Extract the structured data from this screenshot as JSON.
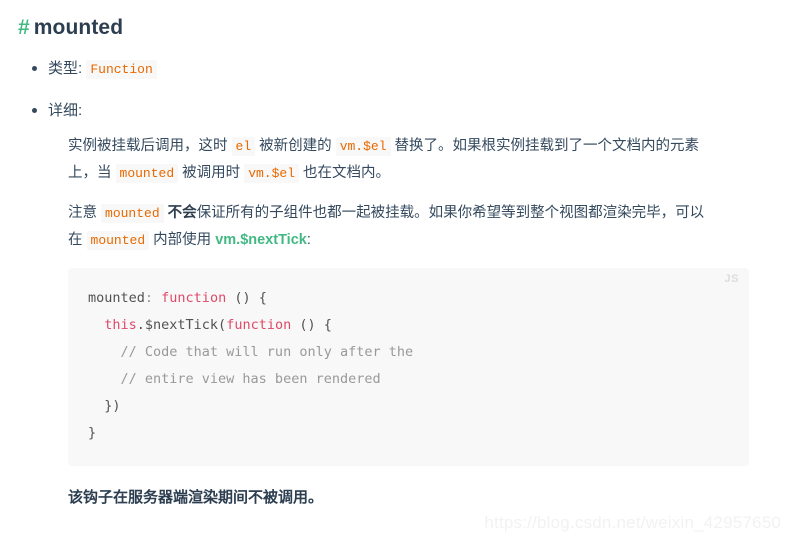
{
  "heading": {
    "anchor": "#",
    "text": "mounted"
  },
  "bullets": [
    {
      "label": "类型:",
      "code": "Function"
    },
    {
      "label": "详细:"
    }
  ],
  "detail": {
    "paragraph1": {
      "part1": "实例被挂载后调用，这时 ",
      "code1": "el",
      "part2": " 被新创建的 ",
      "code2": "vm.$el",
      "part3": " 替换了。如果根实例挂载到了一个文档内的元素上，当 ",
      "code3": "mounted",
      "part4": " 被调用时 ",
      "code4": "vm.$el",
      "part5": " 也在文档内。"
    },
    "paragraph2": {
      "part1": "注意 ",
      "code1": "mounted",
      "part2": " ",
      "bold1": "不会",
      "part3": "保证所有的子组件也都一起被挂载。如果你希望等到整个视图都渲染完毕，可以在 ",
      "code2": "mounted",
      "part4": " 内部使用 ",
      "link1": "vm.$nextTick",
      "part5": ":"
    }
  },
  "code_block": {
    "language_label": "JS",
    "lines": [
      {
        "tokens": [
          {
            "t": "mounted",
            "c": "plain"
          },
          {
            "t": ": ",
            "c": "punc"
          },
          {
            "t": "function",
            "c": "kw"
          },
          {
            "t": " () {",
            "c": "plain"
          }
        ]
      },
      {
        "tokens": [
          {
            "t": "  ",
            "c": "plain"
          },
          {
            "t": "this",
            "c": "this"
          },
          {
            "t": ".$nextTick(",
            "c": "plain"
          },
          {
            "t": "function",
            "c": "kw"
          },
          {
            "t": " () {",
            "c": "plain"
          }
        ]
      },
      {
        "tokens": [
          {
            "t": "    // Code that will run only after the",
            "c": "cmt"
          }
        ]
      },
      {
        "tokens": [
          {
            "t": "    // entire view has been rendered",
            "c": "cmt"
          }
        ]
      },
      {
        "tokens": [
          {
            "t": "  })",
            "c": "plain"
          }
        ]
      },
      {
        "tokens": [
          {
            "t": "}",
            "c": "plain"
          }
        ]
      }
    ],
    "plain_text": "mounted: function () {\n  this.$nextTick(function () {\n    // Code that will run only after the\n    // entire view has been rendered\n  })\n}"
  },
  "closing_note": "该钩子在服务器端渲染期间不被调用。",
  "watermark": "https://blog.csdn.net/weixin_42957650",
  "colors": {
    "accent_green": "#42b983",
    "heading_navy": "#2c3e50",
    "body_text": "#34495e",
    "inline_code": "#e96900",
    "code_keyword": "#dd4a68",
    "code_comment": "#999999",
    "code_bg": "#f8f8f8",
    "watermark": "#f2f2f2"
  }
}
